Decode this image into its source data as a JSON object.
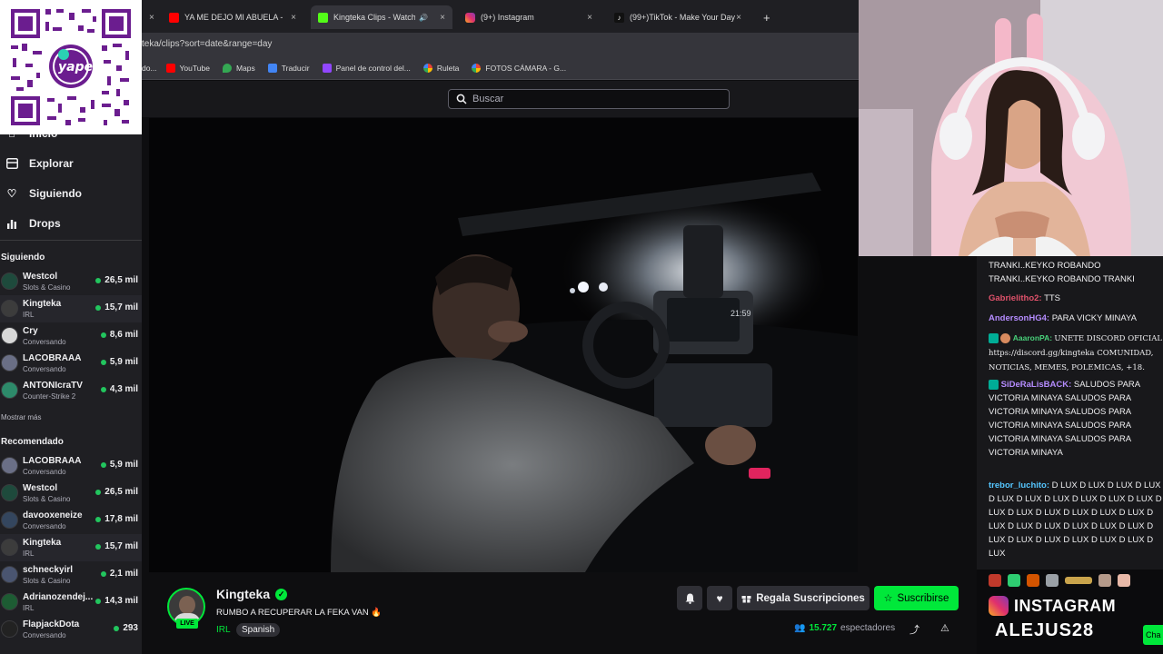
{
  "browser": {
    "tabs": [
      {
        "label": "",
        "close": "×"
      },
      {
        "label": "YA ME DEJO MI ABUELA - PIUR",
        "close": "×"
      },
      {
        "label": "Kingteka Clips - Watch Live",
        "close": "×"
      },
      {
        "label": "(9+) Instagram",
        "close": "×"
      },
      {
        "label": "(99+)TikTok - Make Your Day",
        "close": "×"
      }
    ],
    "new_tab": "+",
    "address": "teka/clips?sort=date&range=day",
    "bookmarks": [
      "do...",
      "YouTube",
      "Maps",
      "Traducir",
      "Panel de control del...",
      "Ruleta",
      "FOTOS CÁMARA - G..."
    ]
  },
  "search": {
    "placeholder": "Buscar"
  },
  "sidebar": {
    "nav": [
      {
        "label": "Inicio",
        "icon": "home-icon"
      },
      {
        "label": "Explorar",
        "icon": "browse-icon"
      },
      {
        "label": "Siguiendo",
        "icon": "heart-icon"
      },
      {
        "label": "Drops",
        "icon": "drops-icon"
      }
    ],
    "following_title": "Siguiendo",
    "following": [
      {
        "name": "Westcol",
        "category": "Slots & Casino",
        "viewers": "26,5 mil"
      },
      {
        "name": "Kingteka",
        "category": "IRL",
        "viewers": "15,7 mil"
      },
      {
        "name": "Cry",
        "category": "Conversando",
        "viewers": "8,6 mil"
      },
      {
        "name": "LACOBRAAA",
        "category": "Conversando",
        "viewers": "5,9 mil"
      },
      {
        "name": "ANTONIcraTV",
        "category": "Counter-Strike 2",
        "viewers": "4,3 mil"
      }
    ],
    "show_more": "Mostrar más",
    "recommended_title": "Recomendado",
    "recommended": [
      {
        "name": "LACOBRAAA",
        "category": "Conversando",
        "viewers": "5,9 mil"
      },
      {
        "name": "Westcol",
        "category": "Slots & Casino",
        "viewers": "26,5 mil"
      },
      {
        "name": "davooxeneize",
        "category": "Conversando",
        "viewers": "17,8 mil"
      },
      {
        "name": "Kingteka",
        "category": "IRL",
        "viewers": "15,7 mil"
      },
      {
        "name": "schneckyirl",
        "category": "Slots & Casino",
        "viewers": "2,1 mil"
      },
      {
        "name": "Adrianozendej...",
        "category": "IRL",
        "viewers": "14,3 mil"
      },
      {
        "name": "FlapjackDota",
        "category": "Conversando",
        "viewers": "293"
      }
    ]
  },
  "qr": {
    "brand": "yape"
  },
  "stream": {
    "channel": "Kingteka",
    "live_badge": "LIVE",
    "title": "RUMBO A RECUPERAR LA FEKA VAN 🔥",
    "category": "IRL",
    "tag": "Spanish",
    "gift_label": "Regala Suscripciones",
    "subscribe_label": "Suscribirse",
    "viewers": "15.727",
    "viewers_label": "espectadores",
    "dash_time": "21:59"
  },
  "chat": {
    "messages": [
      {
        "user": "",
        "text": "TRANKI..KEYKO ROBANDO TRANKI..KEYKO ROBANDO TRANKI",
        "color": "#efeff1"
      },
      {
        "user": "Gabrielitho2:",
        "text": "TTS",
        "color": "#e0526b"
      },
      {
        "user": "AndersonHG4:",
        "text": "PARA VICKY MINAYA",
        "color": "#b58cff"
      },
      {
        "user": "AaaronPA:",
        "text": "UNETE DISCORD OFICIAL https://discord.gg/kingteka COMUNIDAD, NOTICIAS, MEMES, POLEMICAS, +18.",
        "color": "#48d17a"
      },
      {
        "user": "SiDeRaLisBACK:",
        "text": "SALUDOS PARA VICTORIA MINAYA SALUDOS PARA VICTORIA MINAYA SALUDOS PARA VICTORIA MINAYA SALUDOS PARA VICTORIA MINAYA SALUDOS PARA VICTORIA MINAYA",
        "color": "#b58cff"
      },
      {
        "user": "trebor_luchito:",
        "text": "D LUX D LUX D LUX D LUX D LUX D LUX D LUX D LUX D LUX D LUX D LUX D LUX D LUX D LUX D LUX D LUX D LUX D LUX D LUX D LUX D LUX D LUX D LUX D LUX D LUX D LUX D LUX D LUX D LUX",
        "color": "#55c6ff"
      }
    ]
  },
  "overlay": {
    "instagram_label": "INSTAGRAM",
    "handle": "ALEJUS28",
    "chat_button": "Cha"
  },
  "colors": {
    "twitch_purple": "#9147ff",
    "subscribe_green": "#00e83a",
    "live_red": "#eb0400",
    "online_green": "#22c55e"
  }
}
